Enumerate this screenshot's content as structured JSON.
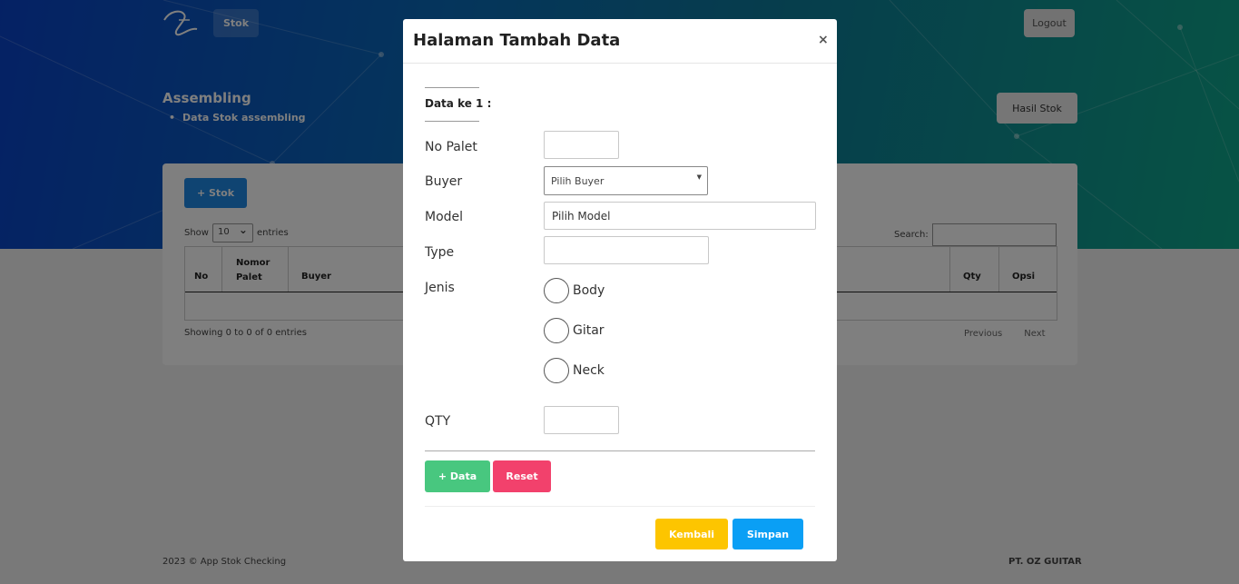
{
  "background": {
    "nav": {
      "stok_label": "Stok",
      "logout_label": "Logout"
    },
    "page": {
      "title": "Assembling",
      "breadcrumb": "Data Stok assembling",
      "hasil_stok_label": "Hasil Stok"
    },
    "card": {
      "add_stok_label": "+ Stok",
      "show_label": "Show",
      "entries_value": "10",
      "entries_label": "entries",
      "search_label": "Search:",
      "columns": [
        "No",
        "Nomor Palet",
        "Buyer",
        "Qty",
        "Opsi"
      ],
      "showing_text": "Showing 0 to 0 of 0 entries",
      "previous_label": "Previous",
      "next_label": "Next"
    },
    "footer": {
      "left": "2023 ©  App Stok Checking",
      "right": "PT. OZ GUITAR"
    }
  },
  "modal": {
    "title": "Halaman Tambah Data",
    "close_label": "×",
    "data_ke_label": "Data ke 1 :",
    "no_palet_label": "No Palet",
    "buyer_label": "Buyer",
    "buyer_value": "Pilih Buyer",
    "model_label": "Model",
    "model_value": "Pilih Model",
    "type_label": "Type",
    "jenis_label": "Jenis",
    "jenis_options": [
      "Body",
      "Gitar",
      "Neck"
    ],
    "qty_label": "QTY",
    "add_data_label": "+ Data",
    "reset_label": "Reset",
    "kembali_label": "Kembali",
    "simpan_label": "Simpan"
  },
  "colors": {
    "add_data": "#48c77f",
    "reset": "#f2416c",
    "kembali": "#fdc500",
    "simpan": "#0a9ff5"
  }
}
